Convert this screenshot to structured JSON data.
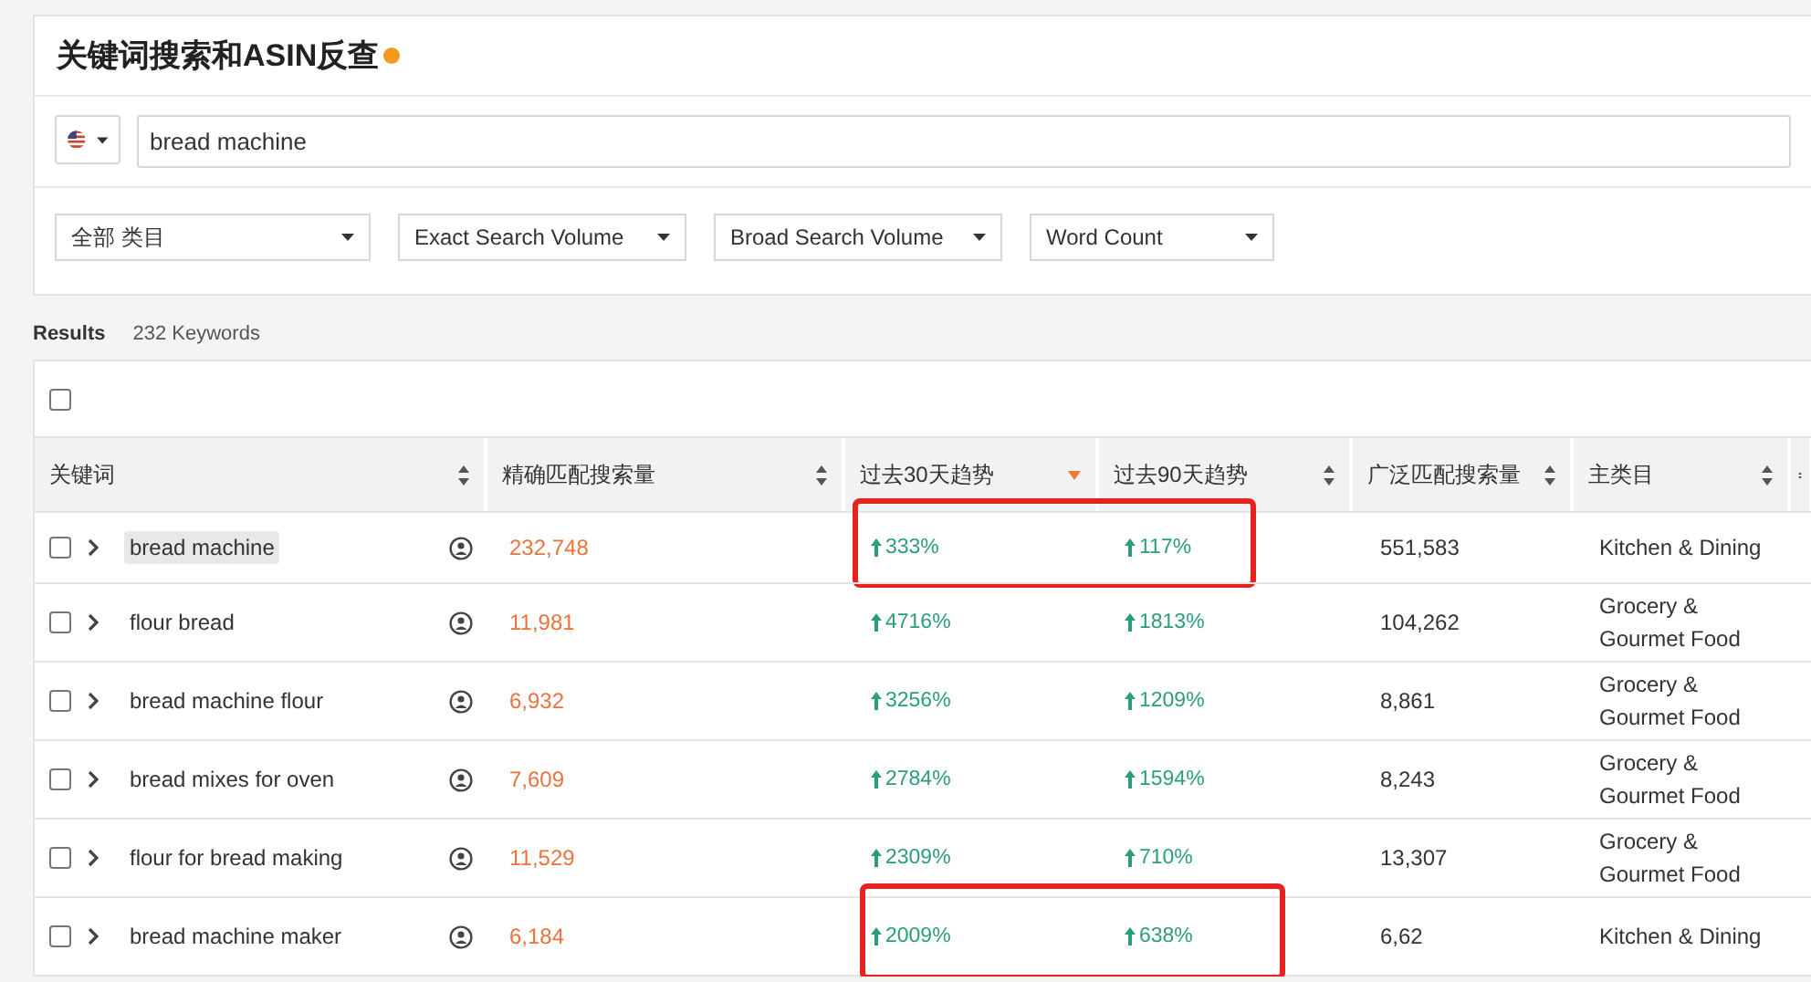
{
  "panel": {
    "title": "关键词搜索和ASIN反查",
    "search": {
      "value": "bread machine"
    },
    "filters": [
      {
        "label": "全部 类目"
      },
      {
        "label": "Exact Search Volume"
      },
      {
        "label": "Broad Search Volume"
      },
      {
        "label": "Word Count"
      }
    ]
  },
  "results": {
    "label": "Results",
    "count": "232 Keywords"
  },
  "table": {
    "select_all": {
      "checked": false
    },
    "columns": [
      {
        "label": "关键词",
        "sorted": false
      },
      {
        "label": "精确匹配搜索量",
        "sorted": false
      },
      {
        "label": "过去30天趋势",
        "sorted": true
      },
      {
        "label": "过去90天趋势",
        "sorted": false
      },
      {
        "label": "广泛匹配搜索量",
        "sorted": false
      },
      {
        "label": "主类目",
        "sorted": false
      }
    ],
    "rows": [
      {
        "checked": false,
        "selected": true,
        "boxed": true,
        "keyword": "bread machine",
        "exact": "232,748",
        "trend_30": "333%",
        "trend_90": "117%",
        "broad": "551,583",
        "category": "Kitchen & Dining"
      },
      {
        "checked": false,
        "selected": false,
        "boxed": false,
        "keyword": "flour bread",
        "exact": "11,981",
        "trend_30": "4716%",
        "trend_90": "1813%",
        "broad": "104,262",
        "category": "Grocery & Gourmet Food"
      },
      {
        "checked": false,
        "selected": false,
        "boxed": false,
        "keyword": "bread machine flour",
        "exact": "6,932",
        "trend_30": "3256%",
        "trend_90": "1209%",
        "broad": "8,861",
        "category": "Grocery & Gourmet Food"
      },
      {
        "checked": false,
        "selected": false,
        "boxed": false,
        "keyword": "bread mixes for oven",
        "exact": "7,609",
        "trend_30": "2784%",
        "trend_90": "1594%",
        "broad": "8,243",
        "category": "Grocery & Gourmet Food"
      },
      {
        "checked": false,
        "selected": false,
        "boxed": false,
        "keyword": "flour for bread making",
        "exact": "11,529",
        "trend_30": "2309%",
        "trend_90": "710%",
        "broad": "13,307",
        "category": "Grocery & Gourmet Food"
      },
      {
        "checked": false,
        "selected": false,
        "boxed": true,
        "keyword": "bread machine maker",
        "exact": "6,184",
        "trend_30": "2009%",
        "trend_90": "638%",
        "broad": "6,62",
        "category": "Kitchen & Dining"
      }
    ]
  }
}
